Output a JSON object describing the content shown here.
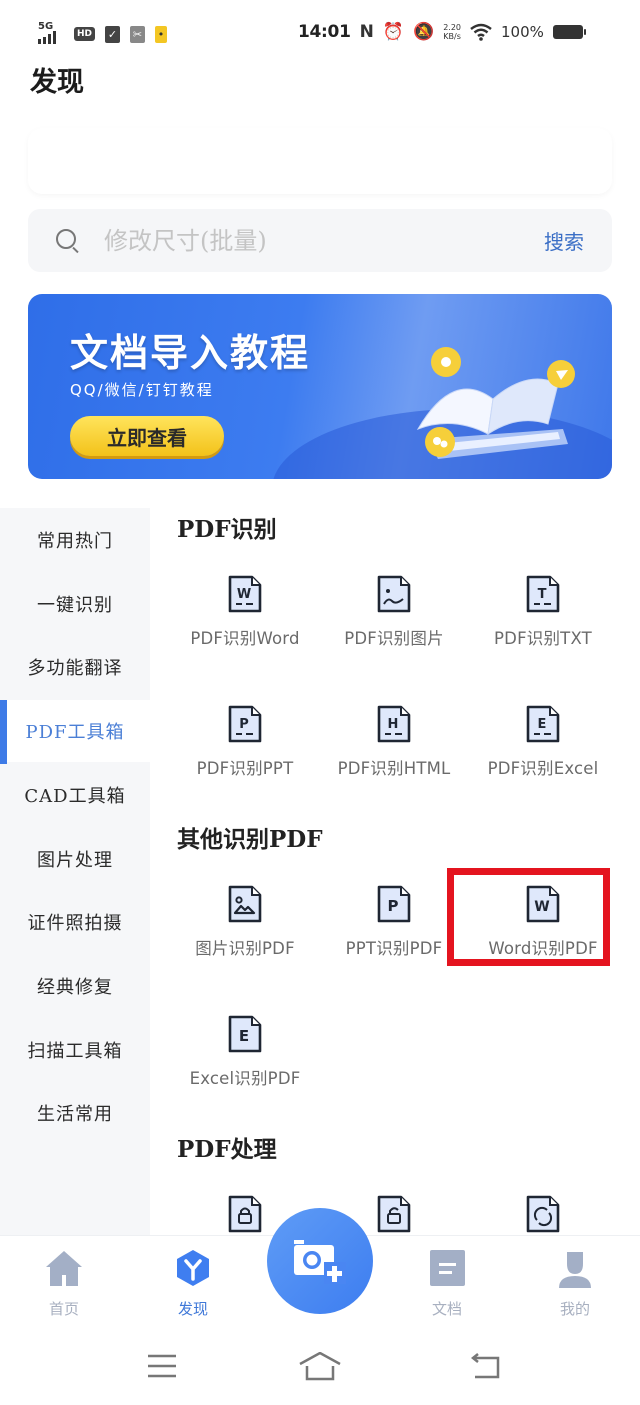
{
  "status_bar": {
    "network": "5G",
    "hd": "HD",
    "time": "14:01",
    "nfc": "N",
    "speed_value": "2.20",
    "speed_unit": "KB/s",
    "battery": "100%"
  },
  "page_title": "发现",
  "search": {
    "placeholder": "修改尺寸(批量)",
    "value": "",
    "button": "搜索"
  },
  "banner": {
    "title": "文档导入教程",
    "subtitle": "QQ/微信/钉钉教程",
    "button": "立即查看"
  },
  "sidebar": {
    "items": [
      {
        "label": "常用热门",
        "active": false
      },
      {
        "label": "一键识别",
        "active": false
      },
      {
        "label": "多功能翻译",
        "active": false
      },
      {
        "label": "PDF工具箱",
        "active": true
      },
      {
        "label": "CAD工具箱",
        "active": false
      },
      {
        "label": "图片处理",
        "active": false
      },
      {
        "label": "证件照拍摄",
        "active": false
      },
      {
        "label": "经典修复",
        "active": false
      },
      {
        "label": "扫描工具箱",
        "active": false
      },
      {
        "label": "生活常用",
        "active": false
      }
    ]
  },
  "sections": [
    {
      "title": "PDF识别",
      "tools": [
        {
          "label": "PDF识别Word",
          "icon": "word-doc-icon",
          "glyph": "W"
        },
        {
          "label": "PDF识别图片",
          "icon": "image-doc-icon",
          "glyph": ""
        },
        {
          "label": "PDF识别TXT",
          "icon": "txt-doc-icon",
          "glyph": "T"
        },
        {
          "label": "PDF识别PPT",
          "icon": "ppt-doc-icon",
          "glyph": "P"
        },
        {
          "label": "PDF识别HTML",
          "icon": "html-doc-icon",
          "glyph": "H"
        },
        {
          "label": "PDF识别Excel",
          "icon": "excel-doc-icon",
          "glyph": "E"
        }
      ]
    },
    {
      "title": "其他识别PDF",
      "tools": [
        {
          "label": "图片识别PDF",
          "icon": "picture-doc-icon",
          "glyph": ""
        },
        {
          "label": "PPT识别PDF",
          "icon": "ppt-doc-icon",
          "glyph": "P"
        },
        {
          "label": "Word识别PDF",
          "icon": "word-doc-icon",
          "glyph": "W",
          "highlighted": true
        },
        {
          "label": "Excel识别PDF",
          "icon": "excel-doc-icon",
          "glyph": "E"
        }
      ]
    },
    {
      "title": "PDF处理",
      "tools": [
        {
          "label": "",
          "icon": "lock-doc-icon"
        },
        {
          "label": "",
          "icon": "unlock-doc-icon"
        },
        {
          "label": "",
          "icon": "rotate-doc-icon"
        }
      ]
    }
  ],
  "bottom_nav": {
    "items": [
      {
        "label": "首页",
        "icon": "home-icon",
        "active": false
      },
      {
        "label": "发现",
        "icon": "discover-icon",
        "active": true
      },
      {
        "label": "文档",
        "icon": "document-icon",
        "active": false
      },
      {
        "label": "我的",
        "icon": "profile-icon",
        "active": false
      }
    ],
    "fab_icon": "camera-add-icon"
  },
  "colors": {
    "accent": "#3e7be7",
    "highlight_box": "#e4141f",
    "banner_button": "#f3c21a",
    "icon_fill": "#dfe8fb"
  }
}
